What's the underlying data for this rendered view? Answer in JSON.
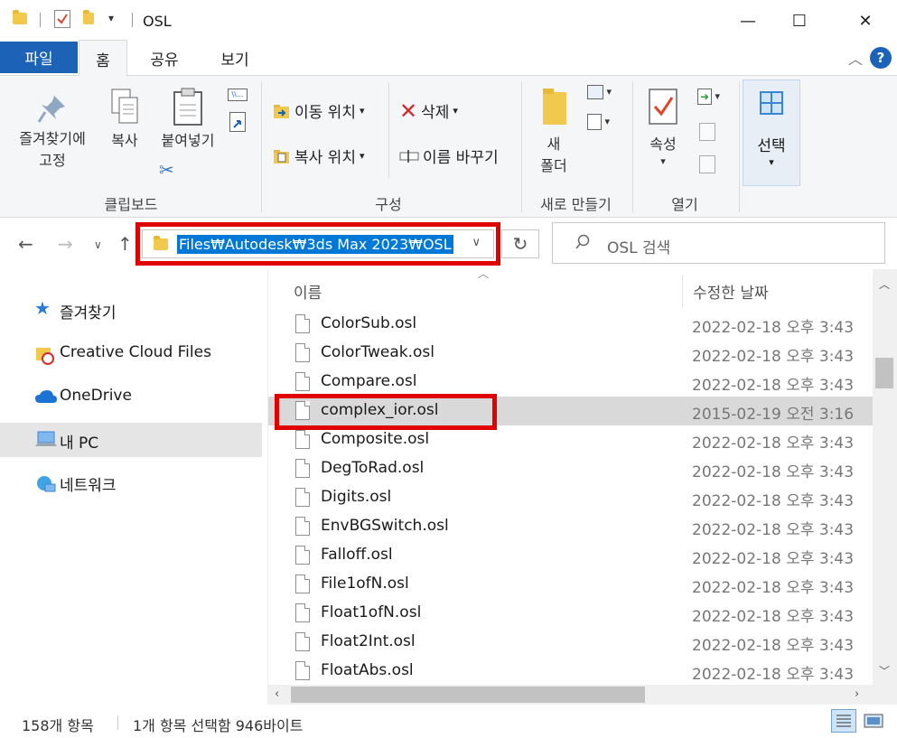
{
  "window": {
    "title": "OSL",
    "minimize": "—",
    "maximize": "☐",
    "close": "✕"
  },
  "ribbon_tabs": [
    "파일",
    "홈",
    "공유",
    "보기"
  ],
  "ribbon": {
    "clipboard": {
      "group_label": "클립보드",
      "pin_label_1": "즐겨찾기에",
      "pin_label_2": "고정",
      "copy_label": "복사",
      "paste_label": "붙여넣기"
    },
    "organize": {
      "group_label": "구성",
      "move_to": "이동 위치",
      "copy_to": "복사 위치",
      "delete": "삭제",
      "rename": "이름 바꾸기"
    },
    "new": {
      "group_label": "새로 만들기",
      "new_folder_1": "새",
      "new_folder_2": "폴더"
    },
    "open": {
      "group_label": "열기",
      "properties": "속성"
    },
    "select": {
      "label": "선택"
    }
  },
  "navbar": {
    "address": "Files₩Autodesk₩3ds Max 2023₩OSL",
    "search_placeholder": "OSL 검색"
  },
  "nav_pane": [
    {
      "label": "즐겨찾기",
      "icon": "star-icon"
    },
    {
      "label": "Creative Cloud Files",
      "icon": "creative-cloud-icon"
    },
    {
      "label": "OneDrive",
      "icon": "onedrive-icon"
    },
    {
      "label": "내 PC",
      "icon": "pc-icon",
      "selected": true
    },
    {
      "label": "네트워크",
      "icon": "network-icon"
    }
  ],
  "file_list": {
    "col_name": "이름",
    "col_date": "수정한 날짜",
    "rows": [
      {
        "name": "ColorSub.osl",
        "date": "2022-02-18 오후 3:43"
      },
      {
        "name": "ColorTweak.osl",
        "date": "2022-02-18 오후 3:43"
      },
      {
        "name": "Compare.osl",
        "date": "2022-02-18 오후 3:43"
      },
      {
        "name": "complex_ior.osl",
        "date": "2015-02-19 오전 3:16",
        "selected": true
      },
      {
        "name": "Composite.osl",
        "date": "2022-02-18 오후 3:43"
      },
      {
        "name": "DegToRad.osl",
        "date": "2022-02-18 오후 3:43"
      },
      {
        "name": "Digits.osl",
        "date": "2022-02-18 오후 3:43"
      },
      {
        "name": "EnvBGSwitch.osl",
        "date": "2022-02-18 오후 3:43"
      },
      {
        "name": "Falloff.osl",
        "date": "2022-02-18 오후 3:43"
      },
      {
        "name": "File1ofN.osl",
        "date": "2022-02-18 오후 3:43"
      },
      {
        "name": "Float1ofN.osl",
        "date": "2022-02-18 오후 3:43"
      },
      {
        "name": "Float2Int.osl",
        "date": "2022-02-18 오후 3:43"
      },
      {
        "name": "FloatAbs.osl",
        "date": "2022-02-18 오후 3:43"
      }
    ]
  },
  "status": {
    "item_count": "158개 항목",
    "selection": "1개 항목 선택함 946바이트"
  },
  "colors": {
    "accent": "#1c63b7",
    "annotation_red": "#e00000",
    "selection_blue": "#0078d7"
  }
}
